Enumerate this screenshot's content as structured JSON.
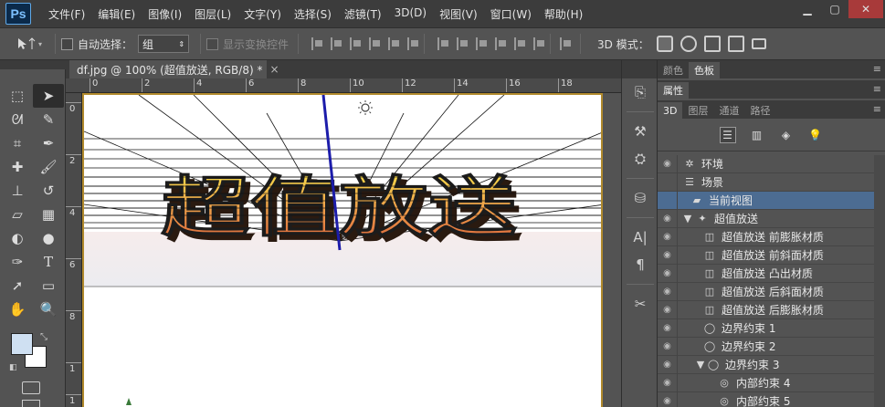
{
  "app": {
    "logo": "Ps"
  },
  "menu": [
    "文件(F)",
    "编辑(E)",
    "图像(I)",
    "图层(L)",
    "文字(Y)",
    "选择(S)",
    "滤镜(T)",
    "3D(D)",
    "视图(V)",
    "窗口(W)",
    "帮助(H)"
  ],
  "options": {
    "auto_select_label": "自动选择：",
    "auto_select_value": "组",
    "show_transform_label": "显示变换控件",
    "mode_3d_label": "3D 模式："
  },
  "document": {
    "tab_title": "df.jpg @ 100% (超值放送, RGB/8) *",
    "close": "×"
  },
  "ruler": {
    "h_labels": [
      "0",
      "2",
      "4",
      "6",
      "8",
      "10",
      "12",
      "14",
      "16",
      "18"
    ],
    "v_labels": [
      "0",
      "2",
      "4",
      "6",
      "8",
      "1",
      "1"
    ]
  },
  "canvas": {
    "headline": "超值放送"
  },
  "panels": {
    "top_tabs": [
      "颜色",
      "色板"
    ],
    "properties_tab": "属性",
    "tabs_3d": [
      "3D",
      "图层",
      "通道",
      "路径"
    ],
    "menu_glyph": "≡"
  },
  "scene_tree": [
    {
      "label": "环境",
      "icon": "environment-icon"
    },
    {
      "label": "场景",
      "icon": "scene-icon"
    },
    {
      "label": "当前视图",
      "icon": "camera-icon",
      "selected": true
    },
    {
      "label": "超值放送",
      "icon": "mesh-icon",
      "expanded": true
    },
    {
      "label": "超值放送 前膨胀材质",
      "icon": "material-icon"
    },
    {
      "label": "超值放送 前斜面材质",
      "icon": "material-icon"
    },
    {
      "label": "超值放送 凸出材质",
      "icon": "material-icon"
    },
    {
      "label": "超值放送 后斜面材质",
      "icon": "material-icon"
    },
    {
      "label": "超值放送 后膨胀材质",
      "icon": "material-icon"
    },
    {
      "label": "边界约束 1",
      "icon": "constraint-icon"
    },
    {
      "label": "边界约束 2",
      "icon": "constraint-icon"
    },
    {
      "label": "边界约束 3",
      "icon": "constraint-icon",
      "expanded": true
    },
    {
      "label": "内部约束 4",
      "icon": "constraint-icon"
    },
    {
      "label": "内部约束 5",
      "icon": "constraint-icon"
    }
  ]
}
